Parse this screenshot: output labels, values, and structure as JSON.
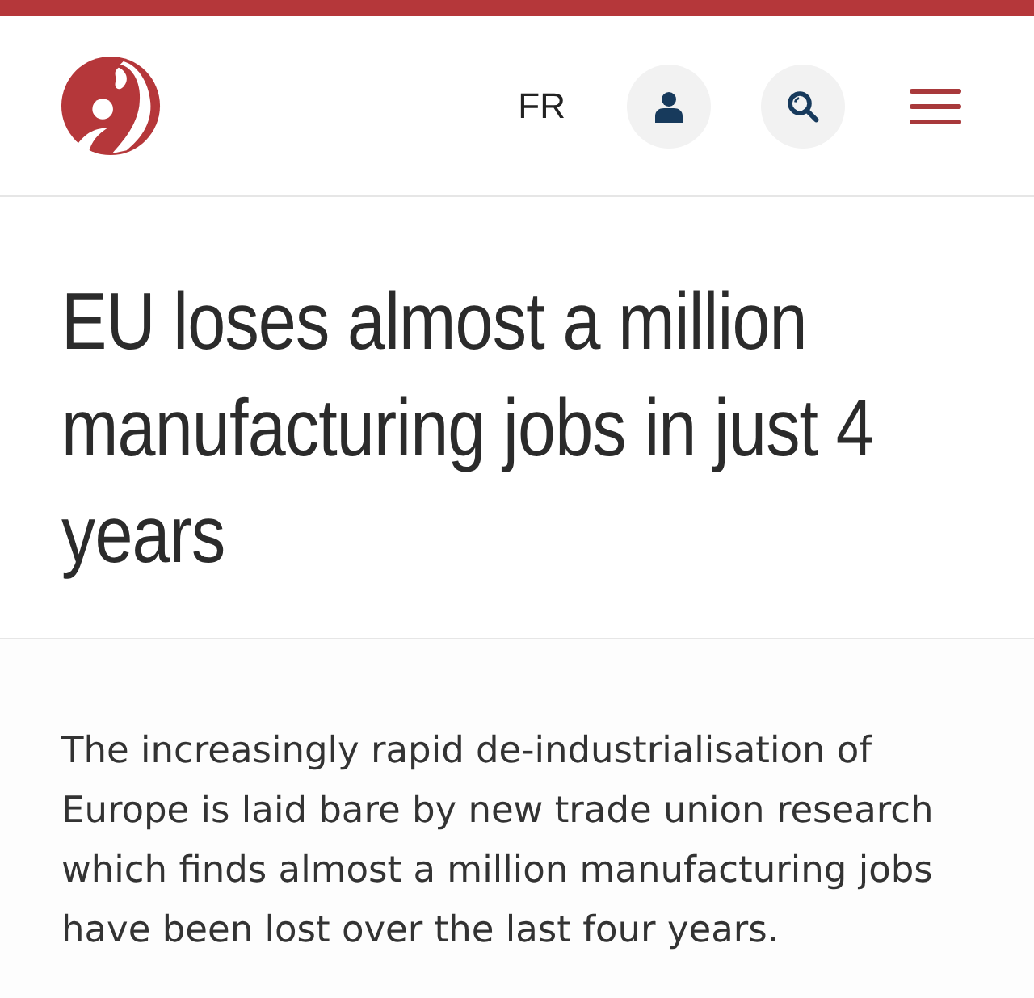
{
  "header": {
    "language": "FR"
  },
  "article": {
    "title": "EU loses almost a million manufacturing jobs in just 4 years",
    "lead": "The increasingly rapid de-industrialisation of Europe is laid bare by new trade union research which finds almost a million manufacturing jobs have been lost over the last four years."
  }
}
